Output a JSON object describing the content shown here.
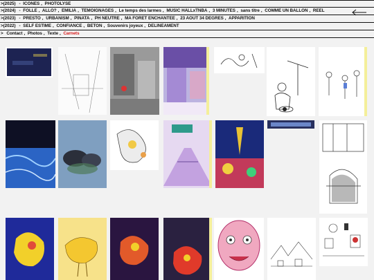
{
  "nav": {
    "rows": [
      {
        "year": ">(2025)",
        "sep": "-",
        "items": [
          "ICONES",
          "PHOTOLYSE"
        ]
      },
      {
        "year": ">(2024)",
        "sep": "-",
        "items": [
          "FOLLE",
          "ALLO?",
          "EMILIA",
          "TEMOIGNAGES",
          "Le temps des larmes",
          "MUSIC HALLxTNBA",
          "3 MINUTES",
          "sans titre",
          "COMME UN BALLON",
          "REEL"
        ]
      },
      {
        "year": ">(2023)",
        "sep": "-",
        "items": [
          "PRESTO",
          "URBANISM",
          "PINATA",
          "PH NEUTRE",
          "MA FORET ENCHANTEE",
          "23 AOUT 34 DEGRES",
          "APPARITION"
        ]
      },
      {
        "year": ">(2022)",
        "sep": "-",
        "items": [
          "SELF ESTIME",
          "CONFIANCE",
          "BETON",
          "Souvenirs joyeux",
          "DELINEAMENT"
        ]
      },
      {
        "year": ">",
        "sep": "",
        "items": [
          "Contact",
          "Photos",
          "Texte",
          "Carnets"
        ]
      }
    ],
    "active_item": "Carnets",
    "active_color": "#d61b1b",
    "back_icon": "arrow-left-icon"
  }
}
